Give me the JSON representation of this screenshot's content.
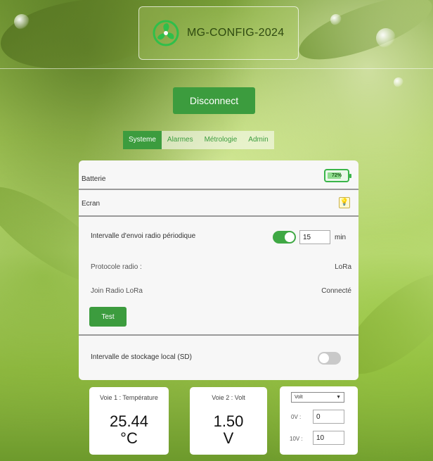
{
  "app": {
    "title": "MG-CONFIG-2024",
    "logo_icon": "fan-icon"
  },
  "header": {
    "disconnect_label": "Disconnect"
  },
  "tabs": [
    {
      "label": "Systeme",
      "active": true
    },
    {
      "label": "Alarmes",
      "active": false
    },
    {
      "label": "Métrologie",
      "active": false
    },
    {
      "label": "Admin",
      "active": false
    }
  ],
  "system": {
    "battery": {
      "label": "Batterie",
      "level_percent": 72,
      "text": "72%"
    },
    "screen": {
      "label": "Ecran",
      "icon": "lightbulb-icon"
    },
    "radio_interval": {
      "label": "Intervalle d'envoi radio périodique",
      "enabled": true,
      "value": "15",
      "unit": "min"
    },
    "radio_protocol": {
      "label": "Protocole radio :",
      "value": "LoRa"
    },
    "join": {
      "label": "Join Radio LoRa",
      "value": "Connecté",
      "test_label": "Test"
    },
    "sd_interval": {
      "label": "Intervalle de stockage local (SD)",
      "enabled": false
    }
  },
  "channels": [
    {
      "title": "Voie 1 : Température",
      "value": "25.44",
      "unit": "°C"
    },
    {
      "title": "Voie 2 : Volt",
      "value": "1.50",
      "unit": "V"
    }
  ],
  "scaling": {
    "selected": "Volt",
    "zero_label": "0V :",
    "zero_value": "0",
    "ten_label": "10V :",
    "ten_value": "10"
  },
  "colors": {
    "accent": "#3c9c3e",
    "toggle_on": "#3fa844",
    "toggle_off": "#c9c9c9"
  }
}
